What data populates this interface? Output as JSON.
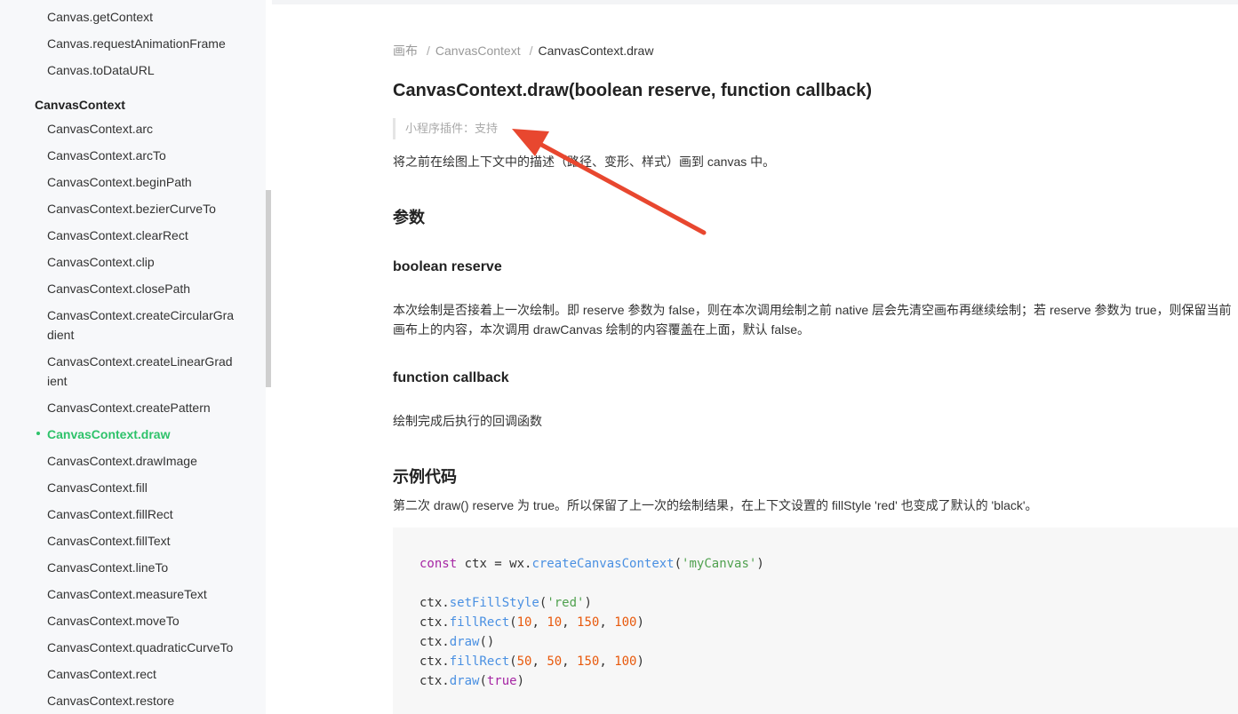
{
  "sidebar": {
    "canvas_items": [
      "Canvas.getContext",
      "Canvas.requestAnimationFrame",
      "Canvas.toDataURL"
    ],
    "group_title": "CanvasContext",
    "items": [
      "CanvasContext.arc",
      "CanvasContext.arcTo",
      "CanvasContext.beginPath",
      "CanvasContext.bezierCurveTo",
      "CanvasContext.clearRect",
      "CanvasContext.clip",
      "CanvasContext.closePath"
    ],
    "wrap_items": [
      {
        "line1": "CanvasContext.createCircularGra",
        "line2": "dient"
      },
      {
        "line1": "CanvasContext.createLinearGrad",
        "line2": "ient"
      }
    ],
    "create_pattern": "CanvasContext.createPattern",
    "active_item": "CanvasContext.draw",
    "rest_items": [
      "CanvasContext.drawImage",
      "CanvasContext.fill",
      "CanvasContext.fillRect",
      "CanvasContext.fillText",
      "CanvasContext.lineTo",
      "CanvasContext.measureText",
      "CanvasContext.moveTo",
      "CanvasContext.quadraticCurveTo",
      "CanvasContext.rect",
      "CanvasContext.restore"
    ]
  },
  "breadcrumb": {
    "root": "画布",
    "parent": "CanvasContext",
    "current": "CanvasContext.draw",
    "separator": "/"
  },
  "page": {
    "title": "CanvasContext.draw(boolean reserve, function callback)",
    "support_note": "小程序插件：支持",
    "description": "将之前在绘图上下文中的描述（路径、变形、样式）画到 canvas 中。",
    "params_heading": "参数",
    "param1_name": "boolean reserve",
    "param1_desc_line1": "本次绘制是否接着上一次绘制。即 reserve 参数为 false，则在本次调用绘制之前 native 层会先清空画布再继续绘制；若 reserve 参数为 true，则保留当前",
    "param1_desc_line2": "画布上的内容，本次调用 drawCanvas 绘制的内容覆盖在上面，默认 false。",
    "param2_name": "function callback",
    "param2_desc": "绘制完成后执行的回调函数",
    "example_heading": "示例代码",
    "example_desc": "第二次 draw() reserve 为 true。所以保留了上一次的绘制结果，在上下文设置的 fillStyle 'red' 也变成了默认的 'black'。"
  },
  "code": {
    "l1_kw": "const",
    "l1_var": " ctx = wx.",
    "l1_fn": "createCanvasContext",
    "l1_open": "(",
    "l1_str": "'myCanvas'",
    "l1_close": ")",
    "ctx": "ctx.",
    "l2_fn": "setFillStyle",
    "l2_str": "'red'",
    "fillRect": "fillRect",
    "draw": "draw",
    "n10": "10",
    "n150": "150",
    "n100": "100",
    "n50": "50",
    "true_kw": "true"
  },
  "colors": {
    "accent": "#2ec26a",
    "arrow": "#e8472f"
  }
}
